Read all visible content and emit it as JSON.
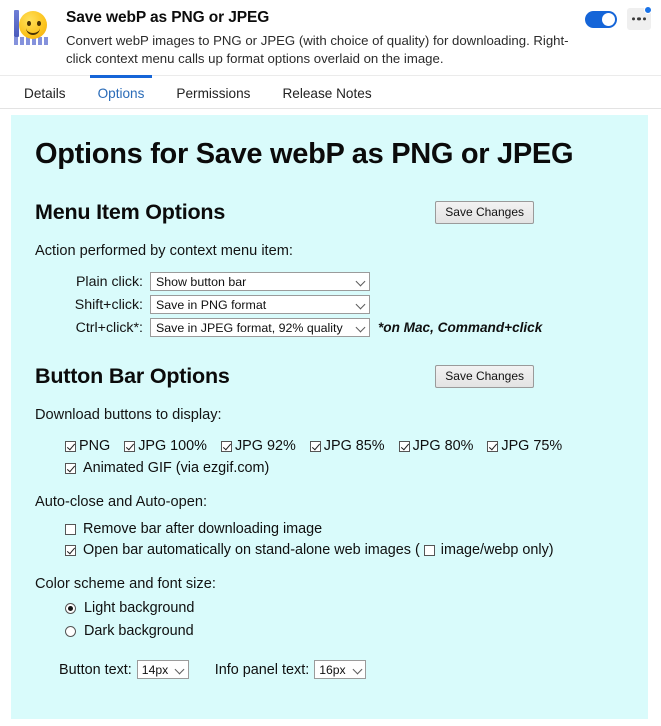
{
  "header": {
    "title": "Save webP as PNG or JPEG",
    "description": "Convert webP images to PNG or JPEG (with choice of quality) for downloading. Right-click context menu calls up format options overlaid on the image.",
    "icon_name": "smiley-face-extension-icon",
    "toggle_state": "on",
    "menu_label": "•••"
  },
  "tabs": [
    {
      "label": "Details",
      "active": false
    },
    {
      "label": "Options",
      "active": true
    },
    {
      "label": "Permissions",
      "active": false
    },
    {
      "label": "Release Notes",
      "active": false
    }
  ],
  "page": {
    "title": "Options for Save webP as PNG or JPEG"
  },
  "menu_item_options": {
    "heading": "Menu Item Options",
    "save_label": "Save Changes",
    "lead": "Action performed by context menu item:",
    "rows": [
      {
        "label": "Plain click:",
        "value": "Show button bar"
      },
      {
        "label": "Shift+click:",
        "value": "Save in PNG format"
      },
      {
        "label": "Ctrl+click*:",
        "value": "Save in JPEG format, 92% quality"
      }
    ],
    "mac_note": "*on Mac, Command+click"
  },
  "button_bar_options": {
    "heading": "Button Bar Options",
    "save_label": "Save Changes",
    "download_lead": "Download buttons to display:",
    "download_buttons": [
      {
        "label": "PNG",
        "checked": true
      },
      {
        "label": "JPG 100%",
        "checked": true
      },
      {
        "label": "JPG 92%",
        "checked": true
      },
      {
        "label": "JPG 85%",
        "checked": true
      },
      {
        "label": "JPG 80%",
        "checked": true
      },
      {
        "label": "JPG 75%",
        "checked": true
      }
    ],
    "animated_gif": {
      "label": "Animated GIF (via ezgif.com)",
      "checked": true
    },
    "autoclose_lead": "Auto-close and Auto-open:",
    "remove_bar": {
      "label": "Remove bar after downloading image",
      "checked": false
    },
    "open_bar_prefix": "Open bar automatically on stand-alone web images (",
    "open_bar_checked": true,
    "webp_only": {
      "label": "image/webp only",
      "checked": false
    },
    "open_bar_suffix": ")",
    "color_lead": "Color scheme and font size:",
    "radios": [
      {
        "label": "Light background",
        "selected": true
      },
      {
        "label": "Dark background",
        "selected": false
      }
    ],
    "button_text_label": "Button text:",
    "button_text_value": "14px",
    "info_text_label": "Info panel text:",
    "info_text_value": "16px"
  },
  "colors": {
    "accent": "#1565d8",
    "page_background": "#d9fbfb",
    "tab_active": "#2b6cb8"
  }
}
